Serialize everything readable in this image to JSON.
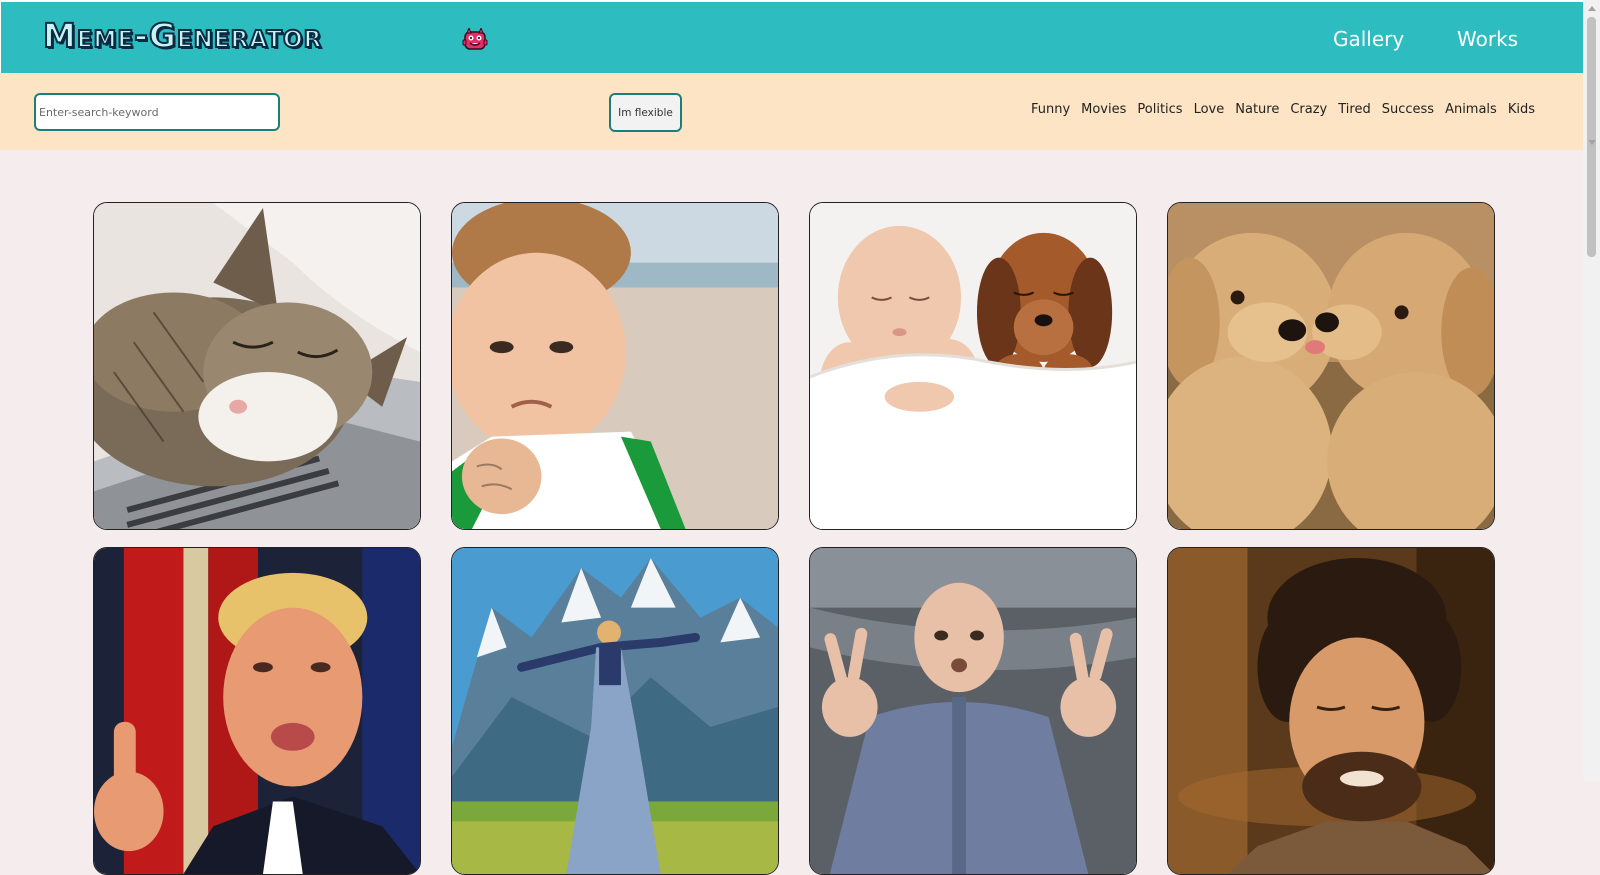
{
  "header": {
    "logo_text": "Meme-Generator",
    "logo_icon": "monster-icon",
    "nav": [
      "Gallery",
      "Works"
    ]
  },
  "filter": {
    "search_placeholder": "Enter-search-keyword",
    "flexible_label": "Im flexible",
    "keywords": [
      "Funny",
      "Movies",
      "Politics",
      "Love",
      "Nature",
      "Crazy",
      "Tired",
      "Success",
      "Animals",
      "Kids"
    ]
  },
  "gallery": {
    "images": [
      "sleeping-cat-on-laptop",
      "success-kid-fist",
      "baby-and-puppy-sleeping",
      "two-puppies-kissing",
      "man-pointing-finger",
      "woman-spinning-in-mountain-meadow",
      "bald-villain-peace-signs",
      "man-with-wild-hair-talking"
    ]
  },
  "colors": {
    "header_bg": "#2dbdc0",
    "filter_bg": "#fde4c4",
    "page_bg": "#f5eded",
    "input_border": "#1a7f7a"
  }
}
